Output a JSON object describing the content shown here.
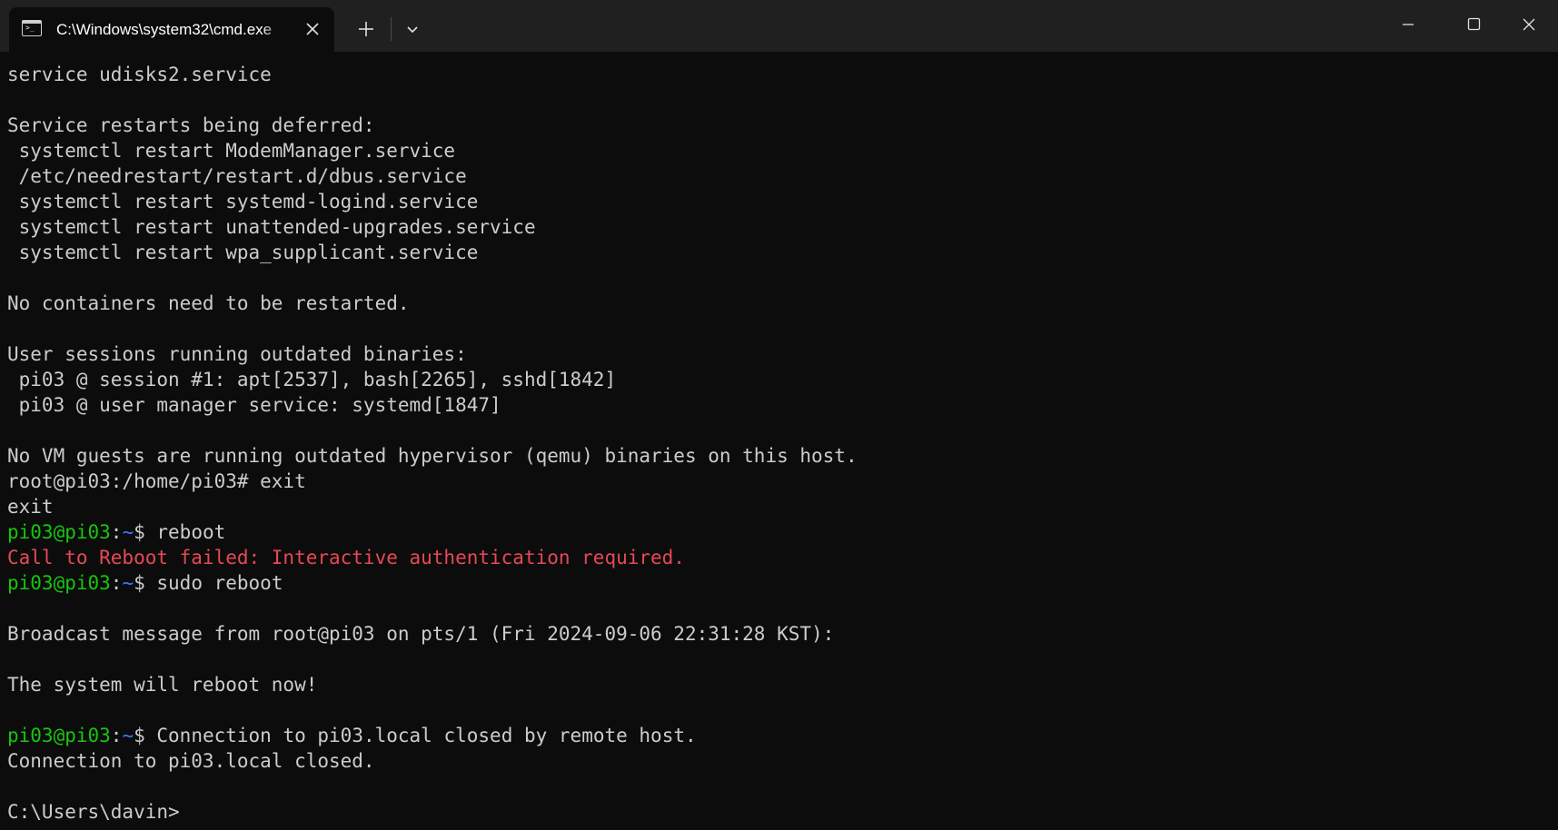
{
  "window": {
    "tab_title": "C:\\Windows\\system32\\cmd.exe",
    "tab_icon": "console-icon",
    "colors": {
      "titlebar": "#202020",
      "background": "#0c0c0c",
      "foreground": "#cccccc",
      "prompt_user": "#16c60c",
      "prompt_path": "#3b78ff",
      "error": "#e74856"
    }
  },
  "terminal": {
    "lines": [
      {
        "segments": [
          {
            "text": "service udisks2.service"
          }
        ]
      },
      {
        "segments": []
      },
      {
        "segments": [
          {
            "text": "Service restarts being deferred:"
          }
        ]
      },
      {
        "segments": [
          {
            "text": " systemctl restart ModemManager.service"
          }
        ]
      },
      {
        "segments": [
          {
            "text": " /etc/needrestart/restart.d/dbus.service"
          }
        ]
      },
      {
        "segments": [
          {
            "text": " systemctl restart systemd-logind.service"
          }
        ]
      },
      {
        "segments": [
          {
            "text": " systemctl restart unattended-upgrades.service"
          }
        ]
      },
      {
        "segments": [
          {
            "text": " systemctl restart wpa_supplicant.service"
          }
        ]
      },
      {
        "segments": []
      },
      {
        "segments": [
          {
            "text": "No containers need to be restarted."
          }
        ]
      },
      {
        "segments": []
      },
      {
        "segments": [
          {
            "text": "User sessions running outdated binaries:"
          }
        ]
      },
      {
        "segments": [
          {
            "text": " pi03 @ session #1: apt[2537], bash[2265], sshd[1842]"
          }
        ]
      },
      {
        "segments": [
          {
            "text": " pi03 @ user manager service: systemd[1847]"
          }
        ]
      },
      {
        "segments": []
      },
      {
        "segments": [
          {
            "text": "No VM guests are running outdated hypervisor (qemu) binaries on this host."
          }
        ]
      },
      {
        "segments": [
          {
            "text": "root@pi03:/home/pi03# exit"
          }
        ]
      },
      {
        "segments": [
          {
            "text": "exit"
          }
        ]
      },
      {
        "segments": [
          {
            "text": "pi03@pi03",
            "color": "green"
          },
          {
            "text": ":"
          },
          {
            "text": "~",
            "color": "blue"
          },
          {
            "text": "$ reboot"
          }
        ]
      },
      {
        "segments": [
          {
            "text": "Call to Reboot failed: Interactive authentication required.",
            "color": "red"
          }
        ]
      },
      {
        "segments": [
          {
            "text": "pi03@pi03",
            "color": "green"
          },
          {
            "text": ":"
          },
          {
            "text": "~",
            "color": "blue"
          },
          {
            "text": "$ sudo reboot"
          }
        ]
      },
      {
        "segments": []
      },
      {
        "segments": [
          {
            "text": "Broadcast message from root@pi03 on pts/1 (Fri 2024-09-06 22:31:28 KST):"
          }
        ]
      },
      {
        "segments": []
      },
      {
        "segments": [
          {
            "text": "The system will reboot now!"
          }
        ]
      },
      {
        "segments": []
      },
      {
        "segments": [
          {
            "text": "pi03@pi03",
            "color": "green"
          },
          {
            "text": ":"
          },
          {
            "text": "~",
            "color": "blue"
          },
          {
            "text": "$ Connection to pi03.local closed by remote host."
          }
        ]
      },
      {
        "segments": [
          {
            "text": "Connection to pi03.local closed."
          }
        ]
      },
      {
        "segments": []
      },
      {
        "segments": [
          {
            "text": "C:\\Users\\davin>"
          }
        ]
      }
    ]
  }
}
